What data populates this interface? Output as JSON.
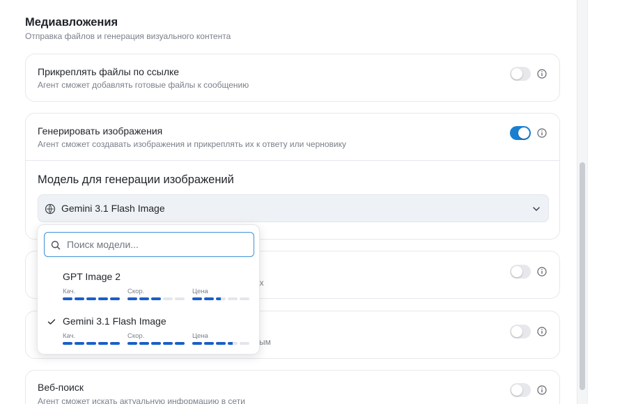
{
  "section": {
    "title": "Медиавложения",
    "subtitle": "Отправка файлов и генерация визуального контента"
  },
  "attach": {
    "title": "Прикреплять файлы по ссылке",
    "desc": "Агент сможет добавлять готовые файлы к сообщению",
    "enabled": false
  },
  "generate": {
    "title": "Генерировать изображения",
    "desc": "Агент сможет создавать изображения и прикреплять их к ответу или черновику",
    "enabled": true,
    "model_heading": "Модель для генерации изображений",
    "selected_model": "Gemini 3.1 Flash Image"
  },
  "hidden_row_1": {
    "desc_tail": "ах",
    "enabled": false
  },
  "hidden_row_2": {
    "desc_tail": "ым",
    "enabled": false
  },
  "websearch": {
    "title": "Веб-поиск",
    "desc": "Агент сможет искать актуальную информацию в сети",
    "enabled": false
  },
  "dropdown": {
    "search_placeholder": "Поиск модели...",
    "metric_labels": [
      "Кач.",
      "Скор.",
      "Цена"
    ],
    "models": [
      {
        "name": "GPT Image 2",
        "selected": false,
        "quality": 5,
        "speed": 3,
        "price": 2.5
      },
      {
        "name": "Gemini 3.1 Flash Image",
        "selected": true,
        "quality": 5,
        "speed": 5,
        "price": 3.5
      }
    ]
  },
  "colors": {
    "accent": "#1a7fd1",
    "bar_fill": "#1a5fc8",
    "bar_empty": "#e3e6ea"
  }
}
